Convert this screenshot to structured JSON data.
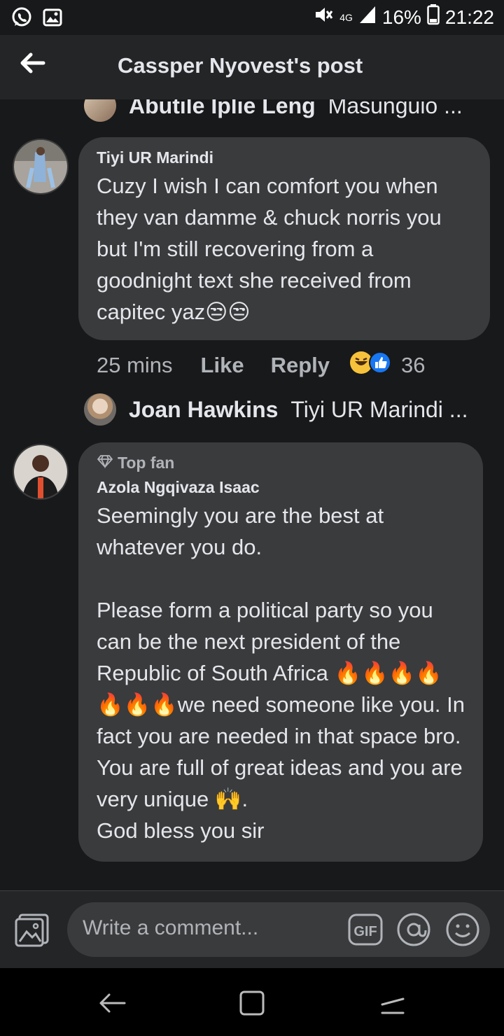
{
  "status_bar": {
    "battery": "16%",
    "time": "21:22",
    "network": "4G",
    "icons": [
      "whatsapp-icon",
      "gallery-icon",
      "mute-icon",
      "signal-icon",
      "battery-icon"
    ]
  },
  "header": {
    "title": "Cassper Nyovest's post",
    "back_icon": "arrow-left-icon"
  },
  "replies": [
    {
      "name": "Abutile Iplie Leng",
      "text": "Masunguio ..."
    },
    {
      "name": "Joan Hawkins",
      "text": "Tiyi UR Marindi ..."
    }
  ],
  "comments": [
    {
      "author": "Tiyi UR Marindi",
      "text": "Cuzy I wish I can comfort you when they van damme & chuck norris you but I'm still recovering from a goodnight text she received from capitec yaz😒😒",
      "time": "25 mins",
      "like_label": "Like",
      "reply_label": "Reply",
      "reaction_count": "36",
      "reactions": [
        "haha-icon",
        "like-icon"
      ]
    },
    {
      "badge": "Top fan",
      "author": "Azola Ngqivaza Isaac",
      "text": "Seemingly you are the best at whatever you do.\n\nPlease form a political party so you can be the next president of the Republic of South Africa 🔥🔥🔥🔥🔥🔥🔥we need someone like you. In fact you are needed in that space bro. You are full of great ideas and you are very unique 🙌.\nGod bless you sir"
    }
  ],
  "composer": {
    "placeholder": "Write a comment...",
    "gif_label": "GIF"
  },
  "colors": {
    "background": "#18191a",
    "bubble": "#3a3b3c",
    "text": "#e4e6eb",
    "muted": "#b0b3b8"
  }
}
